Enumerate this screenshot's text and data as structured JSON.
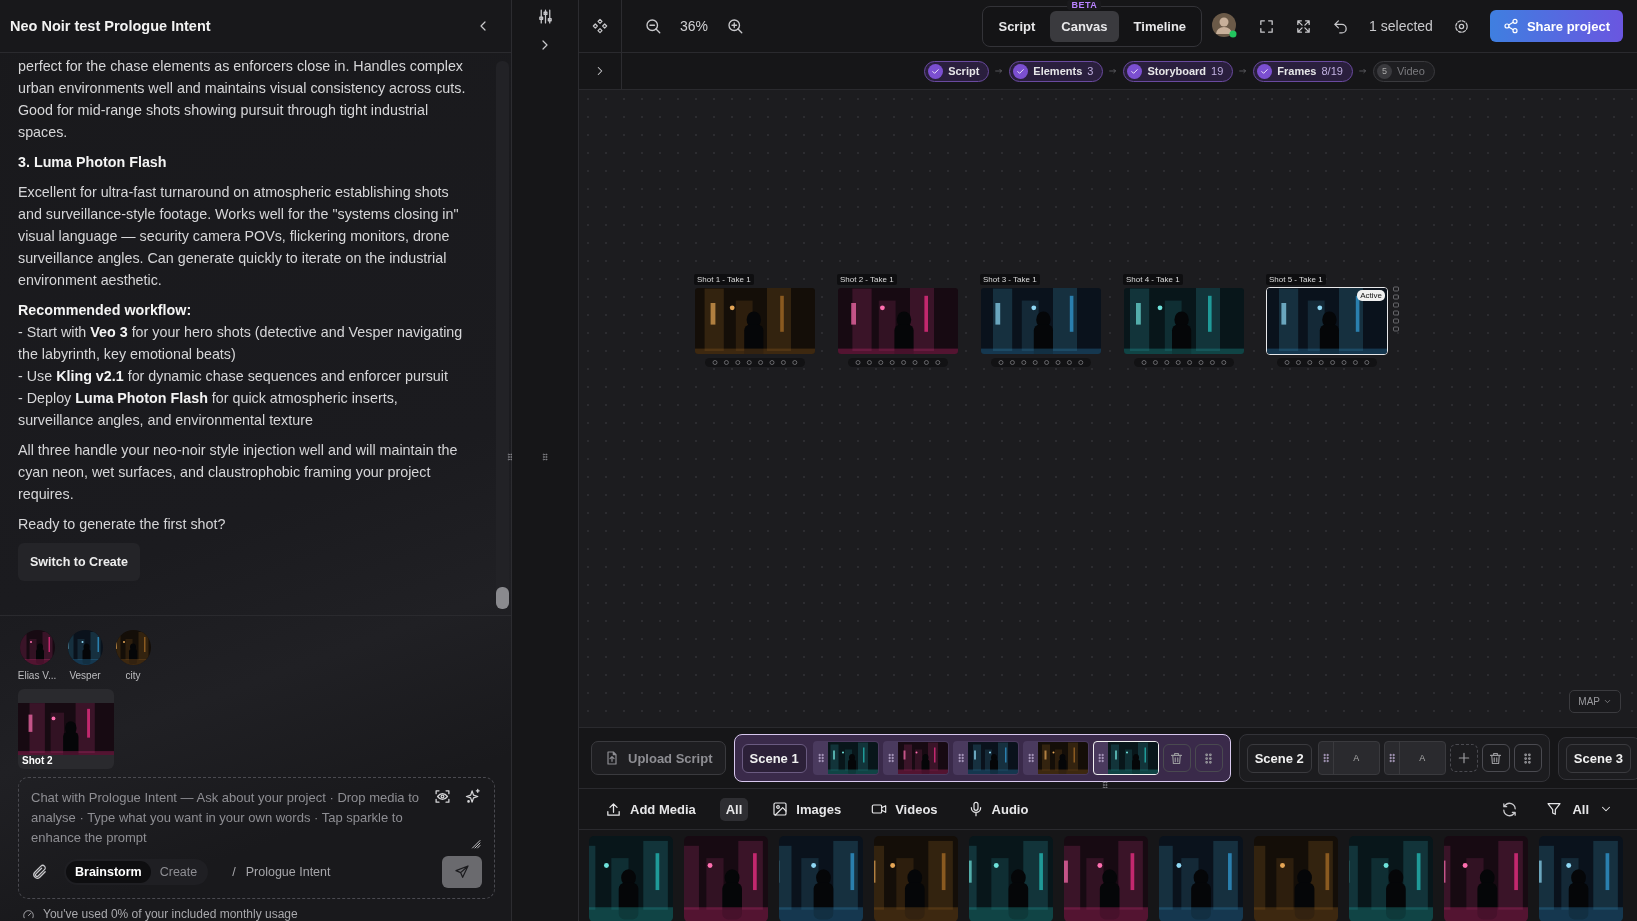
{
  "chat_panel": {
    "title": "Neo Noir test Prologue Intent",
    "messages": [
      {
        "kind": "paragraph",
        "text": "perfect for the chase elements as enforcers close in. Handles complex urban environments well and maintains visual consistency across cuts. Good for mid-range shots showing pursuit through tight industrial spaces."
      },
      {
        "kind": "heading",
        "text": "3. Luma Photon Flash"
      },
      {
        "kind": "paragraph",
        "text": "Excellent for ultra-fast turnaround on atmospheric establishing shots and surveillance-style footage. Works well for the \"systems closing in\" visual language — security camera POVs, flickering monitors, drone surveillance angles. Can generate quickly to iterate on the industrial environment aesthetic."
      },
      {
        "kind": "heading",
        "text": "Recommended workflow:"
      },
      {
        "kind": "line",
        "text": "- Start with **Veo 3** for your hero shots (detective and Vesper navigating the labyrinth, key emotional beats)"
      },
      {
        "kind": "line",
        "text": "- Use **Kling v2.1** for dynamic chase sequences and enforcer pursuit"
      },
      {
        "kind": "line",
        "text": "- Deploy **Luma Photon Flash** for quick atmospheric inserts, surveillance angles, and environmental texture"
      },
      {
        "kind": "paragraph",
        "text": "All three handle your neo-noir style injection well and will maintain the cyan neon, wet surfaces, and claustrophobic framing your project requires."
      },
      {
        "kind": "paragraph",
        "text": "Ready to generate the first shot?"
      }
    ],
    "action_button": "Switch to Create"
  },
  "references": [
    {
      "name": "Elias V..."
    },
    {
      "name": "Vesper"
    },
    {
      "name": "city"
    }
  ],
  "attached_shot": {
    "label": "Shot 2"
  },
  "composer": {
    "placeholder": "Chat with Prologue Intent — Ask about your project · Drop media to analyse · Type what you want in your own words · Tap sparkle to enhance the prompt",
    "modes": [
      {
        "label": "Brainstorm",
        "selected": true
      },
      {
        "label": "Create",
        "selected": false
      }
    ],
    "separator": "/",
    "project": "Prologue Intent"
  },
  "usage": "You've used 0% of your included monthly usage",
  "toolbar": {
    "zoom": "36%",
    "views": [
      {
        "label": "Script",
        "selected": false
      },
      {
        "label": "Canvas",
        "selected": true,
        "badge": "BETA"
      },
      {
        "label": "Timeline",
        "selected": false
      }
    ],
    "selection": "1 selected",
    "share_button": "Share project"
  },
  "pipeline": [
    {
      "label": "Script",
      "done": true
    },
    {
      "label": "Elements",
      "count": "3",
      "done": true
    },
    {
      "label": "Storyboard",
      "count": "19",
      "done": true
    },
    {
      "label": "Frames",
      "count": "8/19",
      "done": true
    },
    {
      "label": "Video",
      "number": "5",
      "done": false
    }
  ],
  "canvas": {
    "frames": [
      {
        "label": "Shot 1 - Take 1",
        "selected": false
      },
      {
        "label": "Shot 2 - Take 1",
        "selected": false
      },
      {
        "label": "Shot 3 - Take 1",
        "selected": false
      },
      {
        "label": "Shot 4 - Take 1",
        "selected": false
      },
      {
        "label": "Shot 5 - Take 1",
        "selected": true,
        "badge": "Active"
      }
    ],
    "map_button": "MAP"
  },
  "upload_button": "Upload Script",
  "scenes": [
    {
      "label": "Scene 1",
      "selected": true,
      "clips": [
        {
          "kind": "picture",
          "selected": false
        },
        {
          "kind": "picture",
          "selected": false
        },
        {
          "kind": "picture",
          "selected": false
        },
        {
          "kind": "picture",
          "selected": false
        },
        {
          "kind": "picture",
          "selected": true
        }
      ]
    },
    {
      "label": "Scene 2",
      "selected": false,
      "clips": [
        {
          "kind": "placeholder",
          "text": "A",
          "selected": false
        },
        {
          "kind": "placeholder",
          "text": "A",
          "selected": false
        }
      ]
    },
    {
      "label": "Scene 3",
      "selected": false
    }
  ],
  "media_bar": {
    "add_button": "Add Media",
    "filters": [
      {
        "label": "All",
        "selected": true
      },
      {
        "label": "Images",
        "selected": false
      },
      {
        "label": "Videos",
        "selected": false
      },
      {
        "label": "Audio",
        "selected": false
      }
    ],
    "filter_value": "All"
  },
  "media": [
    {
      "kind": "picture"
    },
    {
      "kind": "picture"
    },
    {
      "kind": "picture"
    },
    {
      "kind": "picture"
    },
    {
      "kind": "picture"
    },
    {
      "kind": "picture"
    },
    {
      "kind": "picture"
    },
    {
      "kind": "picture"
    },
    {
      "kind": "picture"
    },
    {
      "kind": "picture"
    },
    {
      "kind": "picture"
    }
  ]
}
